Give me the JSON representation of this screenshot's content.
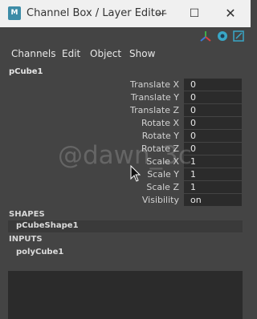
{
  "window": {
    "app_icon_label": "M",
    "title": "Channel Box / Layer Editor",
    "minimize_glyph": "—",
    "maximize_glyph": "☐",
    "close_glyph": "✕"
  },
  "toolbar_icons": [
    "axes-gizmo-icon",
    "channel-box-sphere-icon",
    "open-editor-arrow-icon"
  ],
  "menu": [
    "Channels",
    "Edit",
    "Object",
    "Show"
  ],
  "object": {
    "name": "pCube1",
    "attributes": [
      {
        "label": "Translate X",
        "value": "0"
      },
      {
        "label": "Translate Y",
        "value": "0"
      },
      {
        "label": "Translate Z",
        "value": "0"
      },
      {
        "label": "Rotate X",
        "value": "0"
      },
      {
        "label": "Rotate Y",
        "value": "0"
      },
      {
        "label": "Rotate Z",
        "value": "0"
      },
      {
        "label": "Scale X",
        "value": "1"
      },
      {
        "label": "Scale Y",
        "value": "1"
      },
      {
        "label": "Scale Z",
        "value": "1"
      },
      {
        "label": "Visibility",
        "value": "on"
      }
    ]
  },
  "shapes": {
    "heading": "SHAPES",
    "items": [
      "pCubeShape1"
    ]
  },
  "inputs": {
    "heading": "INPUTS",
    "items": [
      "polyCube1"
    ]
  },
  "watermark": "@dawn_3c",
  "colors": {
    "background": "#444444",
    "field": "#2b2b2b",
    "titlebar": "#f0f0f0",
    "app_icon": "#3d8ca7"
  }
}
